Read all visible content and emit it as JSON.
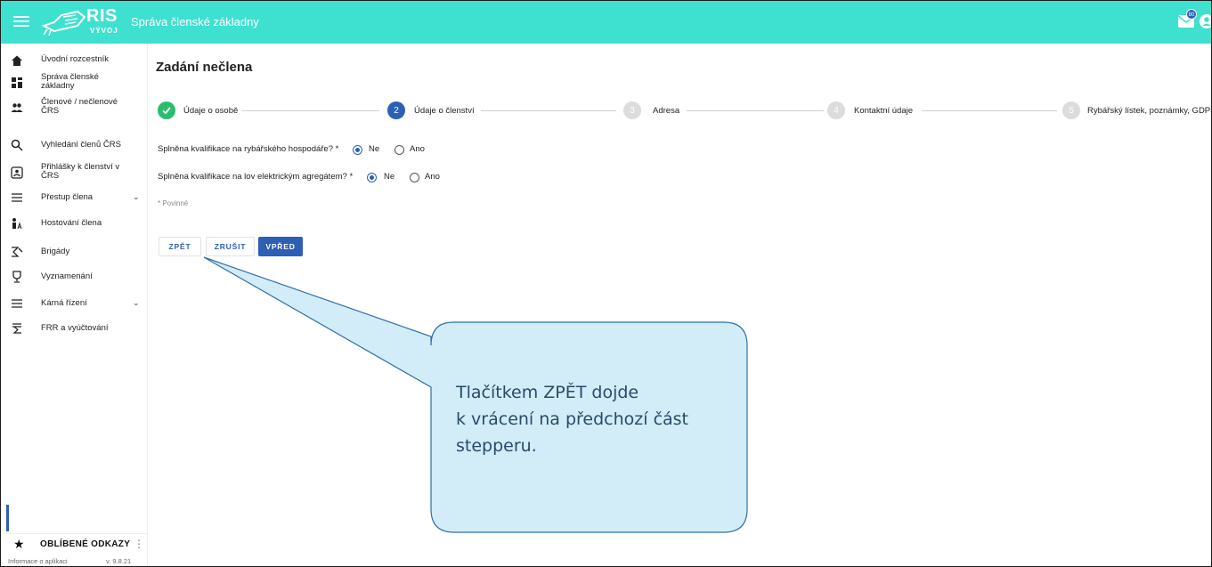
{
  "app": {
    "logo_text": "RIS",
    "logo_sub": "VÝVOJ",
    "title": "Správa členské základny",
    "mail_badge": "80"
  },
  "sidebar": {
    "items": [
      {
        "label": "Úvodní rozcestník",
        "icon": "home-icon"
      },
      {
        "label": "Správa členské základny",
        "icon": "dashboard-icon"
      },
      {
        "label": "Členové / nečlenové ČRS",
        "icon": "people-icon"
      },
      {
        "label": "Vyhledání členů ČRS",
        "icon": "search-icon"
      },
      {
        "label": "Přihlášky k členství v ČRS",
        "icon": "application-icon"
      },
      {
        "label": "Přestup člena",
        "icon": "list-icon"
      },
      {
        "label": "Hostování člena",
        "icon": "guest-icon"
      },
      {
        "label": "Brigády",
        "icon": "brigade-icon"
      },
      {
        "label": "Vyznamenání",
        "icon": "trophy-icon"
      },
      {
        "label": "Kárná řízení",
        "icon": "list-icon"
      },
      {
        "label": "FRR a vyúčtování",
        "icon": "sum-icon"
      }
    ],
    "favorites_label": "OBLÍBENÉ ODKAZY",
    "info_label": "Informace o aplikaci",
    "version": "v. 9.8.21"
  },
  "main": {
    "page_title": "Zadání nečlena",
    "steps": [
      {
        "number": "✓",
        "label": "Údaje o osobě",
        "state": "done"
      },
      {
        "number": "2",
        "label": "Údaje o členství",
        "state": "active"
      },
      {
        "number": "3",
        "label": "Adresa",
        "state": "pending"
      },
      {
        "number": "4",
        "label": "Kontaktní údaje",
        "state": "pending"
      },
      {
        "number": "5",
        "label": "Rybářský lístek, poznámky, GDPR",
        "state": "pending"
      }
    ],
    "questions": [
      {
        "label": "Splněna kvalifikace na rybářského hospodáře? *",
        "option_no": "Ne",
        "option_yes": "Ano",
        "selected": "Ne"
      },
      {
        "label": "Splněna kvalifikace na lov elektrickým agregátem? *",
        "option_no": "Ne",
        "option_yes": "Ano",
        "selected": "Ne"
      }
    ],
    "required_note": "* Povinné",
    "buttons": {
      "back": "ZPĚT",
      "cancel": "ZRUŠIT",
      "next": "VPŘED"
    }
  },
  "callout": {
    "line1": "Tlačítkem ZPĚT dojde",
    "line2": "k vrácení na předchozí část",
    "line3": "stepperu."
  },
  "colors": {
    "topbar": "#3ee0cf",
    "accent": "#2c5fb5",
    "done": "#2bbd6e",
    "pending": "#dcdcdc",
    "callout_fill": "#d2ecf8",
    "callout_stroke": "#2f6ea8"
  }
}
